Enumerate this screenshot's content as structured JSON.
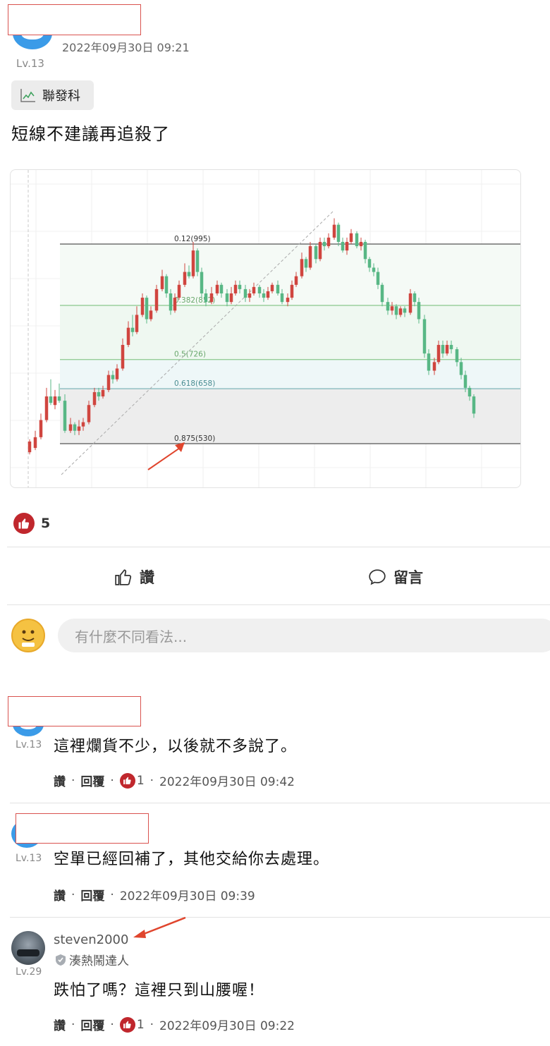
{
  "post": {
    "time": "2022年09月30日 09:21",
    "level": "Lv.13",
    "stock_tag": "聯發科",
    "text": "短線不建議再追殺了",
    "like_count": "5",
    "like_action": "讚",
    "comment_action": "留言"
  },
  "comment_box": {
    "placeholder": "有什麼不同看法..."
  },
  "chart_data": {
    "type": "candlestick",
    "fib_levels": [
      {
        "label": "0.12(995)",
        "value": 995
      },
      {
        "label": "0.382(852)",
        "value": 852
      },
      {
        "label": "0.5(726)",
        "value": 726
      },
      {
        "label": "0.618(658)",
        "value": 658
      },
      {
        "label": "0.875(530)",
        "value": 530
      }
    ],
    "colors": {
      "up": "#d0453f",
      "down": "#58b785",
      "fib_line": "#8bc88d",
      "arrow": "#e0452d"
    }
  },
  "comments": [
    {
      "level": "Lv.13",
      "text": "這裡爛貨不少，以後就不多說了。",
      "like": "讚",
      "reply": "回覆",
      "likes": "1",
      "time": "2022年09月30日 09:42"
    },
    {
      "level": "Lv.13",
      "text": "空單已經回補了，其他交給你去處理。",
      "like": "讚",
      "reply": "回覆",
      "time": "2022年09月30日 09:39"
    },
    {
      "username": "steven2000",
      "badge": "湊熱鬧達人",
      "level": "Lv.29",
      "text": "跌怕了嗎？這裡只到山腰喔！",
      "like": "讚",
      "reply": "回覆",
      "likes": "1",
      "time": "2022年09月30日 09:22"
    }
  ],
  "sep": "·"
}
